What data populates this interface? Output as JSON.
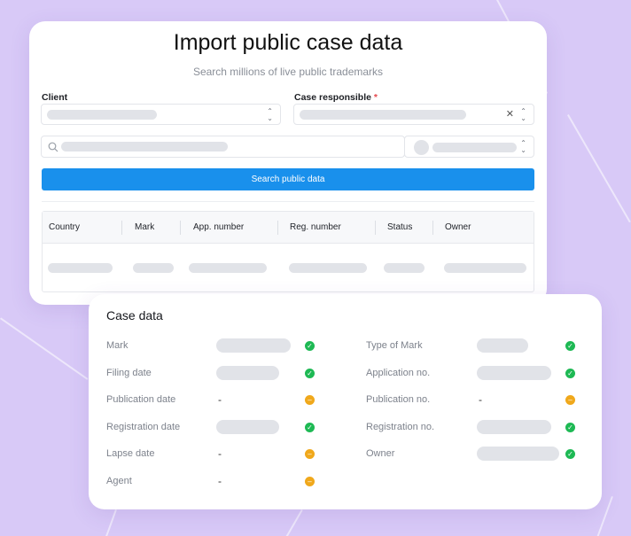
{
  "import_card": {
    "title": "Import public case data",
    "subtitle": "Search millions of live public trademarks",
    "client_label": "Client",
    "case_responsible_label": "Case responsible",
    "required_mark": "*",
    "search_button": "Search public data",
    "table_headers": [
      "Country",
      "Mark",
      "App. number",
      "Reg. number",
      "Status",
      "Owner"
    ]
  },
  "case_card": {
    "title": "Case data",
    "left_rows": [
      {
        "label": "Mark",
        "value": "",
        "status": "ok"
      },
      {
        "label": "Filing date",
        "value": "",
        "status": "ok"
      },
      {
        "label": "Publication date",
        "value": "-",
        "status": "warn"
      },
      {
        "label": "Registration date",
        "value": "",
        "status": "ok"
      },
      {
        "label": "Lapse date",
        "value": "-",
        "status": "warn"
      },
      {
        "label": "Agent",
        "value": "-",
        "status": "warn"
      }
    ],
    "right_rows": [
      {
        "label": "Type of Mark",
        "value": "",
        "status": "ok"
      },
      {
        "label": "Application no.",
        "value": "",
        "status": "ok"
      },
      {
        "label": "Publication no.",
        "value": "-",
        "status": "warn"
      },
      {
        "label": "Registration no.",
        "value": "",
        "status": "ok"
      },
      {
        "label": "Owner",
        "value": "",
        "status": "ok"
      }
    ]
  },
  "icons": {
    "search": "search-icon",
    "clear": "close-icon",
    "sort": "chevron-updown-icon",
    "ok": "check-icon",
    "warn": "minus-icon"
  },
  "colors": {
    "accent": "#1990ec",
    "ok": "#1eb954",
    "warn": "#f0a81b",
    "background": "#d8c9f7"
  }
}
